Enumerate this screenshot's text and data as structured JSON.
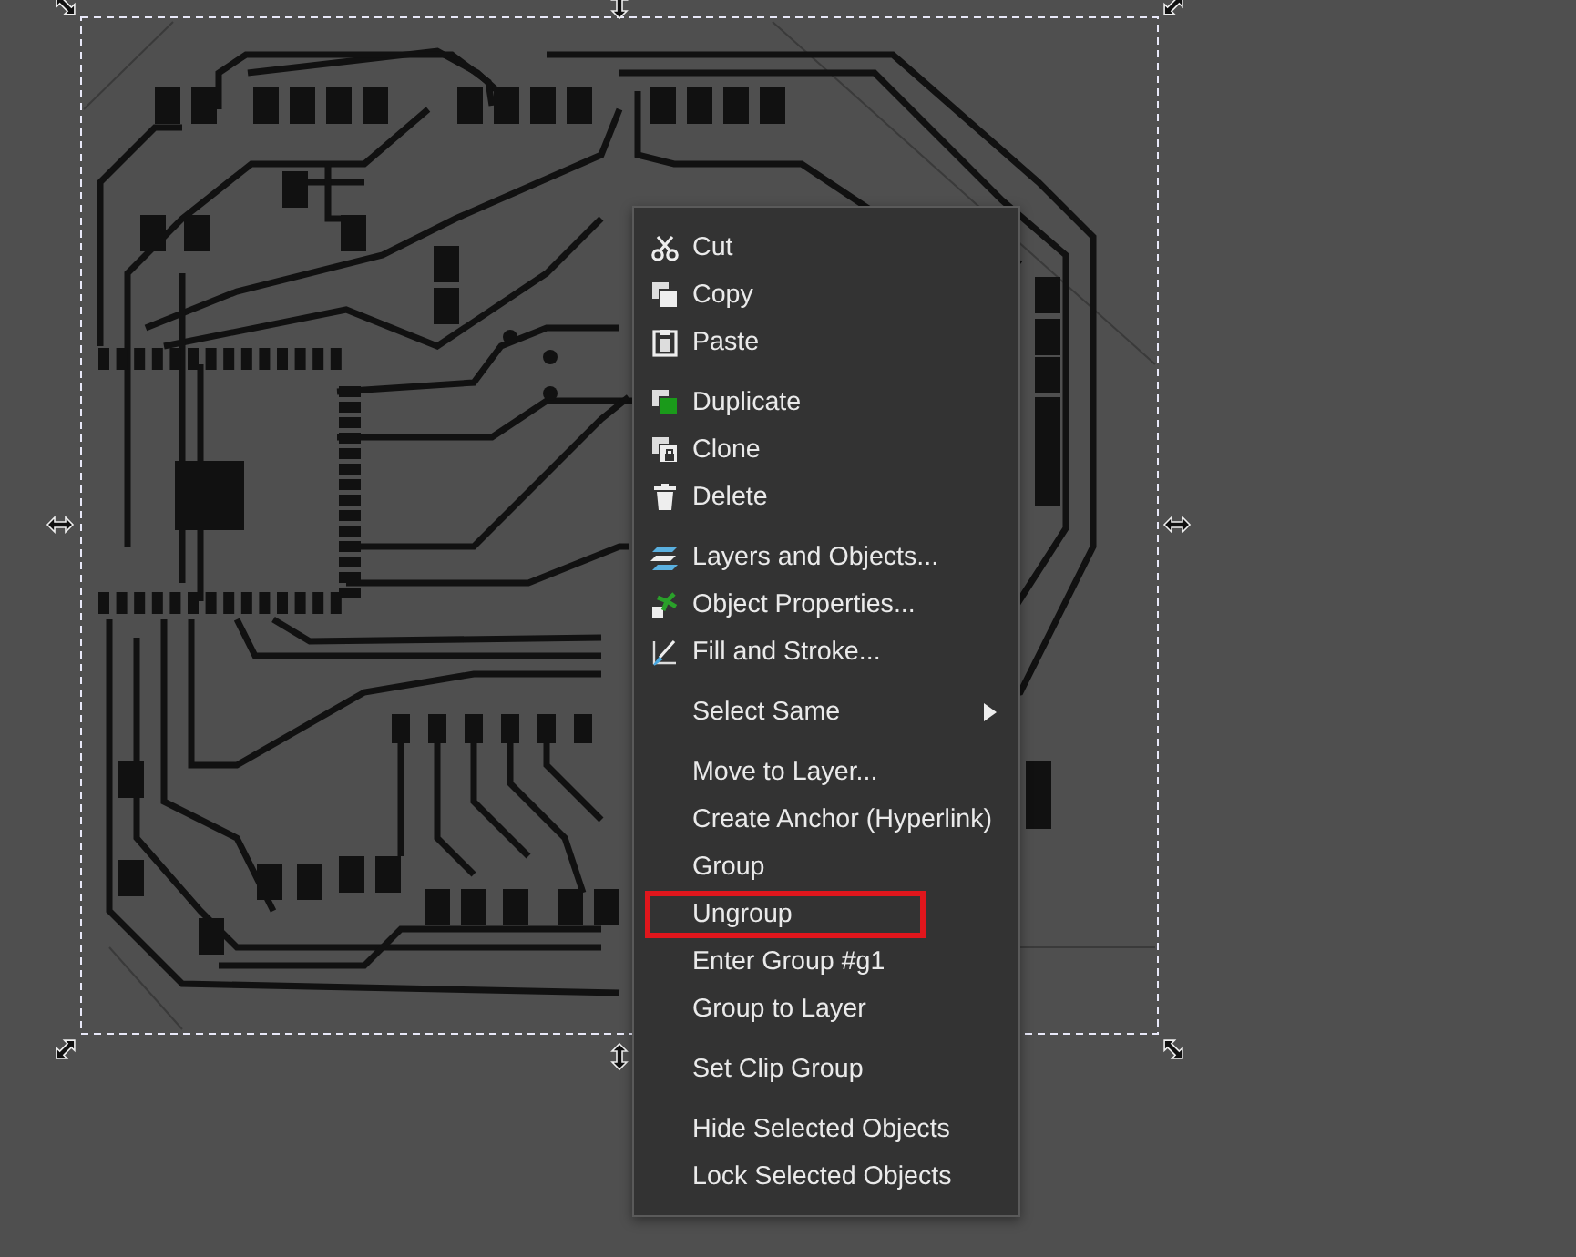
{
  "context_menu": {
    "groups": [
      [
        {
          "label": "Cut",
          "kind": "scissors",
          "submenu": false,
          "marked": false
        },
        {
          "label": "Copy",
          "kind": "copy",
          "submenu": false,
          "marked": false
        },
        {
          "label": "Paste",
          "kind": "paste",
          "submenu": false,
          "marked": false
        }
      ],
      [
        {
          "label": "Duplicate",
          "kind": "duplicate",
          "submenu": false,
          "marked": false
        },
        {
          "label": "Clone",
          "kind": "clone",
          "submenu": false,
          "marked": false
        },
        {
          "label": "Delete",
          "kind": "trash",
          "submenu": false,
          "marked": false
        }
      ],
      [
        {
          "label": "Layers and Objects...",
          "kind": "layers",
          "submenu": false,
          "marked": false
        },
        {
          "label": "Object Properties...",
          "kind": "properties",
          "submenu": false,
          "marked": false
        },
        {
          "label": "Fill and Stroke...",
          "kind": "brush",
          "submenu": false,
          "marked": false
        }
      ],
      [
        {
          "label": "Select Same",
          "kind": "none",
          "submenu": true,
          "marked": false
        }
      ],
      [
        {
          "label": "Move to Layer...",
          "kind": "none",
          "submenu": false,
          "marked": false
        },
        {
          "label": "Create Anchor (Hyperlink)",
          "kind": "none",
          "submenu": false,
          "marked": false
        },
        {
          "label": "Group",
          "kind": "none",
          "submenu": false,
          "marked": false
        },
        {
          "label": "Ungroup",
          "kind": "none",
          "submenu": false,
          "marked": true
        },
        {
          "label": "Enter Group #g1",
          "kind": "none",
          "submenu": false,
          "marked": false
        },
        {
          "label": "Group to Layer",
          "kind": "none",
          "submenu": false,
          "marked": false
        }
      ],
      [
        {
          "label": "Set Clip Group",
          "kind": "none",
          "submenu": false,
          "marked": false
        }
      ],
      [
        {
          "label": "Hide Selected Objects",
          "kind": "none",
          "submenu": false,
          "marked": false
        },
        {
          "label": "Lock Selected Objects",
          "kind": "none",
          "submenu": false,
          "marked": false
        }
      ]
    ]
  }
}
